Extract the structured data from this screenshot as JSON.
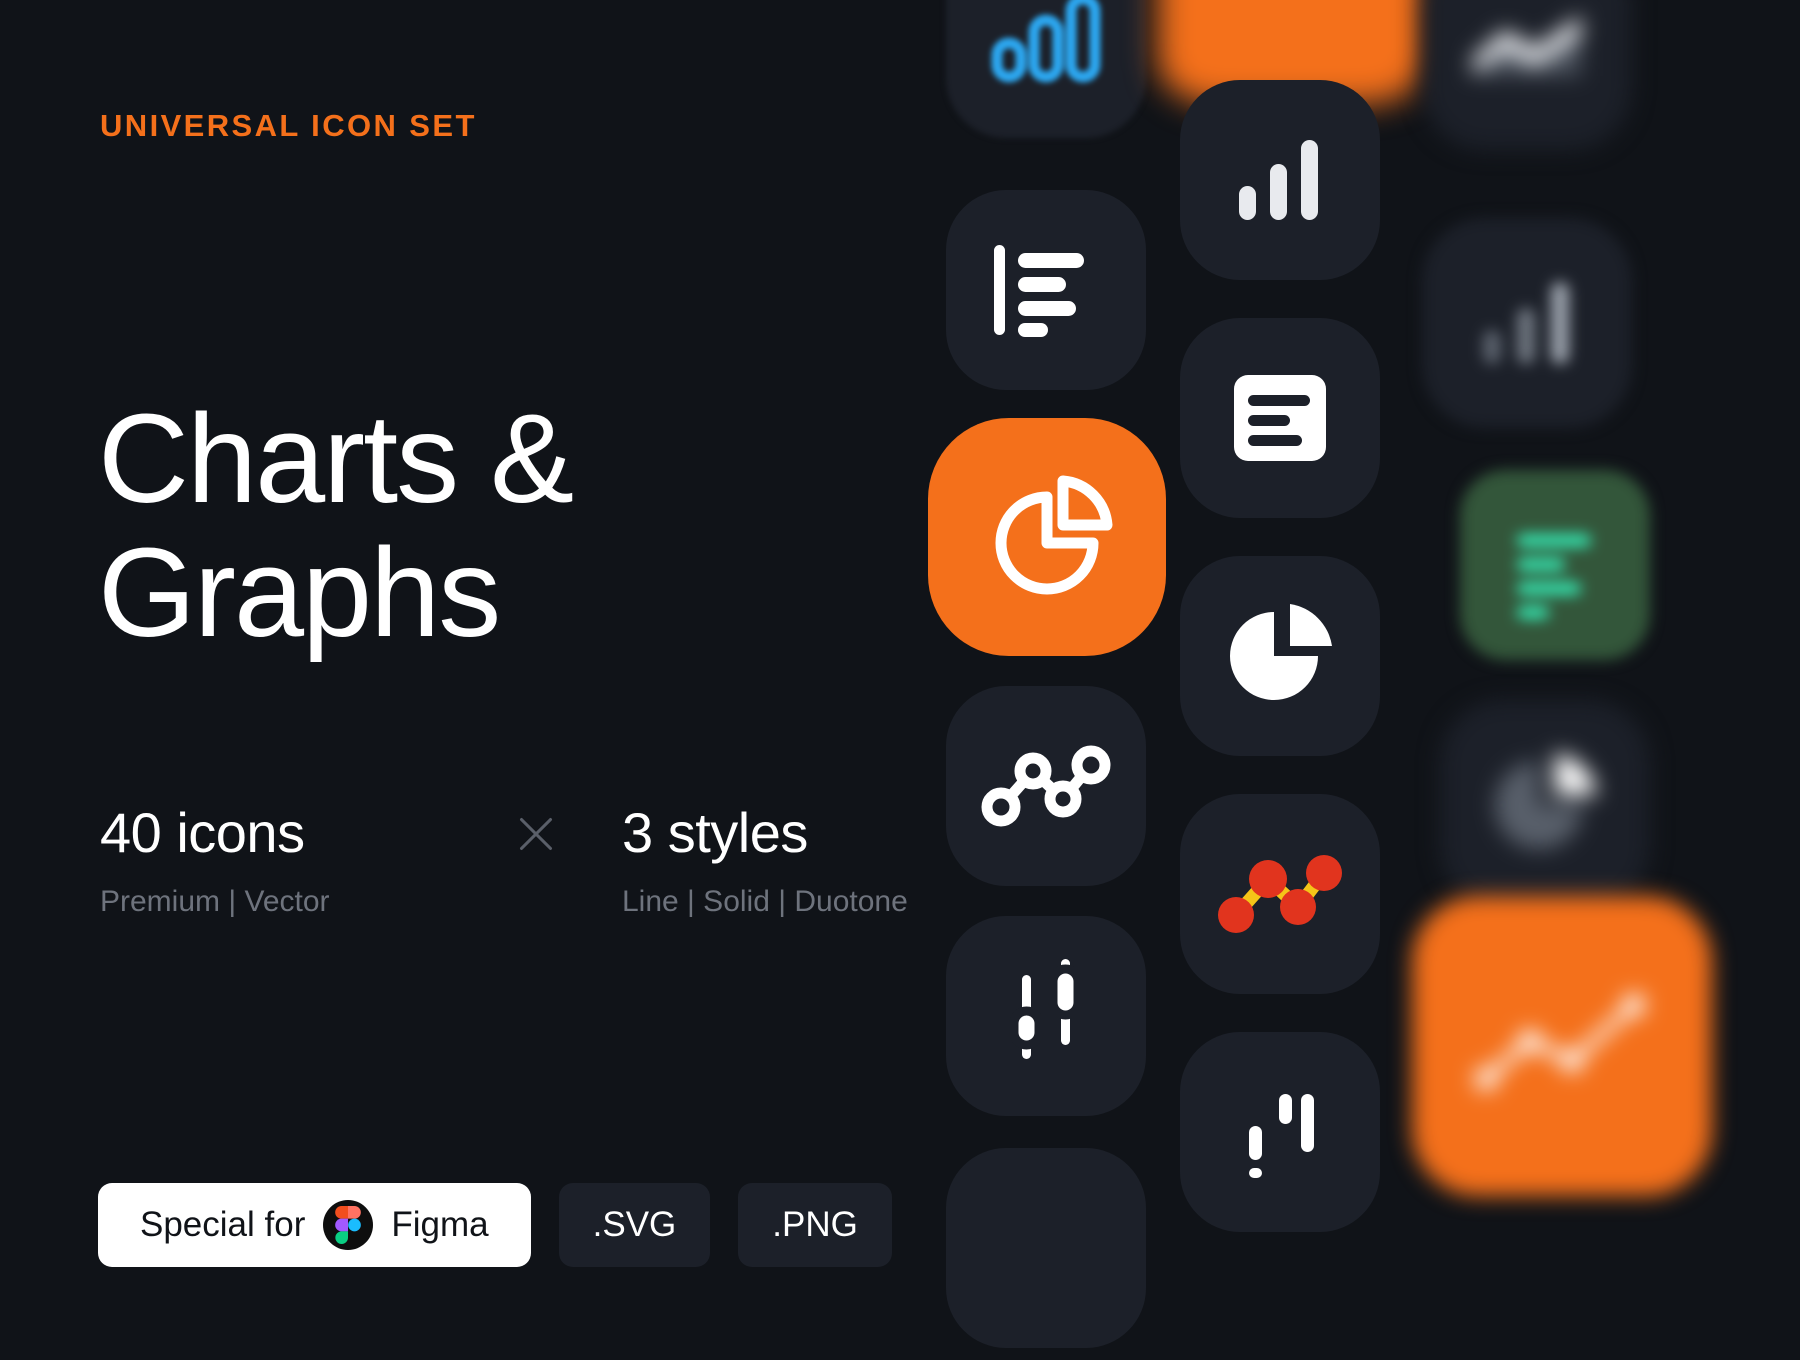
{
  "meta": {
    "background_color": "#101318",
    "accent_color": "#F4701B",
    "tile_color": "#1C2029",
    "text_color": "#FFFFFF",
    "muted_text_color": "#6E737D"
  },
  "left_panel": {
    "eyebrow": "UNIVERSAL ICON SET",
    "title_line_1": "Charts &",
    "title_line_2": "Graphs",
    "stats": [
      {
        "value": "40 icons",
        "sub": "Premium | Vector"
      },
      {
        "value": "3 styles",
        "sub": "Line | Solid | Duotone"
      }
    ],
    "separator_icon": "x-multiply-icon",
    "badges": {
      "figma_prefix": "Special for",
      "figma_label": "Figma",
      "figma_logo_icon": "figma-logo-icon",
      "formats": [
        ".SVG",
        ".PNG"
      ]
    }
  },
  "icon_grid": {
    "tiles": [
      {
        "name": "bar-chart-ascending-outline-icon",
        "style": "line",
        "color": "#2CA7F0",
        "tile": "dark"
      },
      {
        "name": "bar-chart-horizontal-solid-icon",
        "style": "solid",
        "color": "#FFFFFF",
        "tile": "dark"
      },
      {
        "name": "pie-chart-line-icon",
        "style": "line",
        "color": "#FFFFFF",
        "tile": "orange",
        "featured": true
      },
      {
        "name": "connected-scatter-line-icon",
        "style": "line",
        "color": "#FFFFFF",
        "tile": "dark"
      },
      {
        "name": "candlestick-chart-solid-icon",
        "style": "solid",
        "color": "#FFFFFF",
        "tile": "dark"
      },
      {
        "name": "bar-chart-solid-icon",
        "style": "solid",
        "color": "#E8EAEE",
        "tile": "dark"
      },
      {
        "name": "document-bars-solid-icon",
        "style": "solid",
        "color": "#FFFFFF",
        "tile": "dark"
      },
      {
        "name": "pie-chart-solid-icon",
        "style": "solid",
        "color": "#FFFFFF",
        "tile": "dark"
      },
      {
        "name": "connected-scatter-duotone-icon",
        "style": "duotone",
        "color": "#E1341E",
        "accent": "#F5C518",
        "tile": "dark"
      },
      {
        "name": "bar-chart-axis-solid-icon",
        "style": "solid",
        "color": "#FFFFFF",
        "tile": "dark"
      },
      {
        "name": "area-chart-solid-icon",
        "style": "solid",
        "color": "#8B919C",
        "tile": "dark"
      },
      {
        "name": "bar-chart-duotone-icon",
        "style": "duotone",
        "color": "#6E737D",
        "tile": "dark"
      },
      {
        "name": "document-bars-duotone-icon",
        "style": "duotone",
        "color": "#35E6B0",
        "tile": "green"
      },
      {
        "name": "pie-chart-duotone-icon",
        "style": "duotone",
        "color": "#FFFFFF",
        "tile": "dark"
      },
      {
        "name": "line-chart-points-solid-icon",
        "style": "solid",
        "color": "#FFFFFF",
        "tile": "orange"
      },
      {
        "name": "tile-blank-orange",
        "style": "solid",
        "tile": "orange"
      }
    ]
  }
}
